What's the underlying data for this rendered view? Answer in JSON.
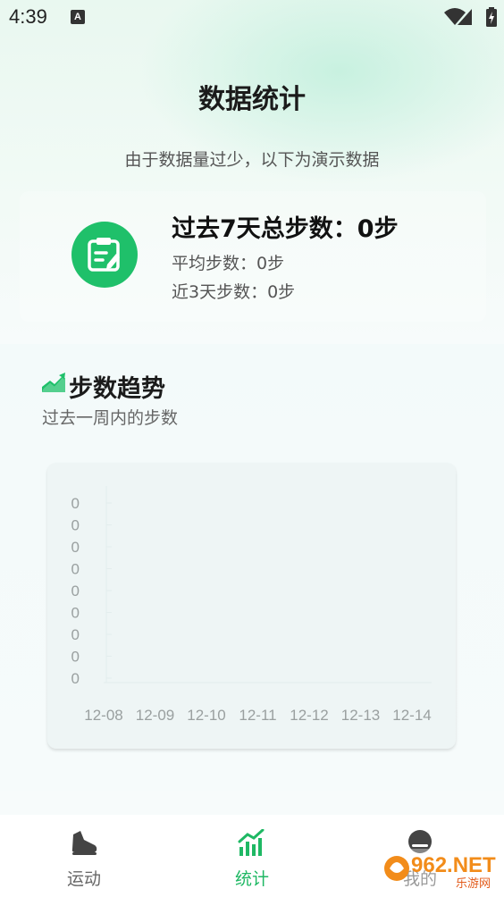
{
  "status_bar": {
    "time": "4:39",
    "notification_icon": "A"
  },
  "page": {
    "title": "数据统计",
    "notice": "由于数据量过少，以下为演示数据"
  },
  "summary": {
    "icon": "clipboard-edit-icon",
    "total_steps": "过去7天总步数：0步",
    "avg_steps": "平均步数：0步",
    "three_days_steps": "近3天步数：0步"
  },
  "trend": {
    "icon": "trend-up-icon",
    "title": "步数趋势",
    "subtitle": "过去一周内的步数"
  },
  "chart_data": {
    "type": "line",
    "categories": [
      "12-08",
      "12-09",
      "12-10",
      "12-11",
      "12-12",
      "12-13",
      "12-14"
    ],
    "values": [
      0,
      0,
      0,
      0,
      0,
      0,
      0
    ],
    "y_tick_labels": [
      "0",
      "0",
      "0",
      "0",
      "0",
      "0",
      "0",
      "0",
      "0"
    ],
    "grid": true
  },
  "bottom_nav": {
    "items": [
      {
        "label": "运动",
        "icon": "shoe-icon",
        "active": false
      },
      {
        "label": "统计",
        "icon": "bar-chart-icon",
        "active": true
      },
      {
        "label": "我的",
        "icon": "profile-icon",
        "active": false
      }
    ]
  },
  "watermark": {
    "text": "962.NET",
    "sub": "乐游网"
  },
  "colors": {
    "accent": "#1fc06a",
    "active_nav": "#1fb864"
  }
}
